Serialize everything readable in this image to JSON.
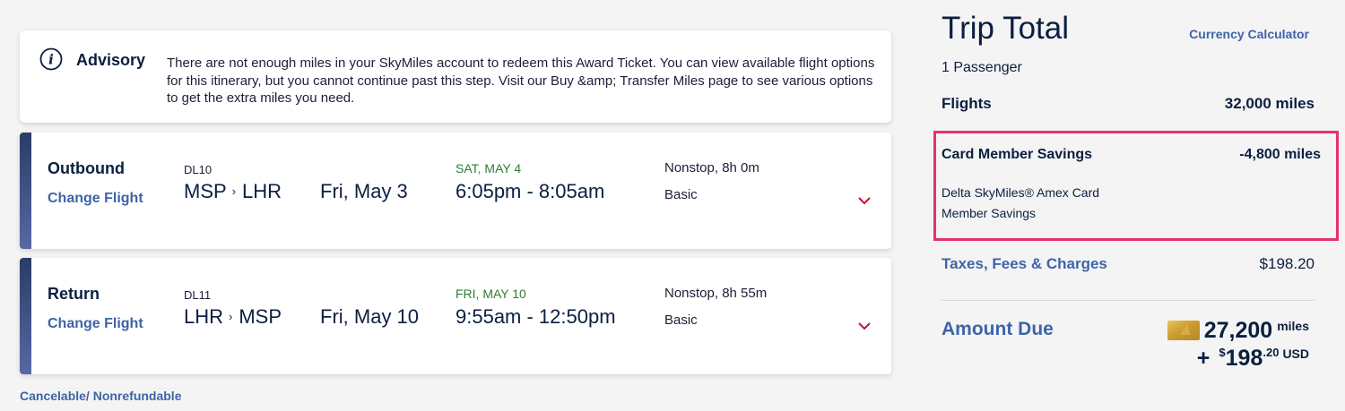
{
  "advisory": {
    "title": "Advisory",
    "message": "There are not enough miles in your SkyMiles account to redeem this Award Ticket. You can view available flight options for this itinerary, but you cannot continue past this step. Visit our Buy &amp; Transfer Miles page to see various options to get the extra miles you need.",
    "icon": "info-icon"
  },
  "flights": [
    {
      "direction": "Outbound",
      "change_label": "Change Flight",
      "flight_number": "DL10",
      "origin": "MSP",
      "destination": "LHR",
      "date": "Fri, May 3",
      "arrival_date": "SAT, MAY 4",
      "times": "6:05pm - 8:05am",
      "stops_duration": "Nonstop, 8h 0m",
      "cabin": "Basic"
    },
    {
      "direction": "Return",
      "change_label": "Change Flight",
      "flight_number": "DL11",
      "origin": "LHR",
      "destination": "MSP",
      "date": "Fri, May 10",
      "arrival_date": "FRI, MAY 10",
      "times": "9:55am - 12:50pm",
      "stops_duration": "Nonstop, 8h 55m",
      "cabin": "Basic"
    }
  ],
  "fare_note": "Cancelable/ Nonrefundable",
  "trip_total": {
    "title": "Trip Total",
    "currency_link": "Currency Calculator",
    "passengers": "1 Passenger",
    "flights_label": "Flights",
    "flights_value": "32,000 miles",
    "savings_label": "Card Member Savings",
    "savings_value": "-4,800 miles",
    "savings_desc": "Delta SkyMiles® Amex Card Member Savings",
    "taxes_label": "Taxes, Fees & Charges",
    "taxes_value": "$198.20",
    "amount_due_label": "Amount Due",
    "due_miles": "27,200",
    "due_miles_unit": "miles",
    "due_plus": "+",
    "due_currency_symbol": "$",
    "due_usd_whole": "198",
    "due_usd_cents": ".20",
    "due_usd_unit": "USD"
  },
  "colors": {
    "accent_blue": "#3e64a8",
    "navy": "#0b1f3f",
    "highlight_pink": "#e8306f",
    "arrival_green": "#2e7d32",
    "chevron_red": "#c8102e"
  }
}
